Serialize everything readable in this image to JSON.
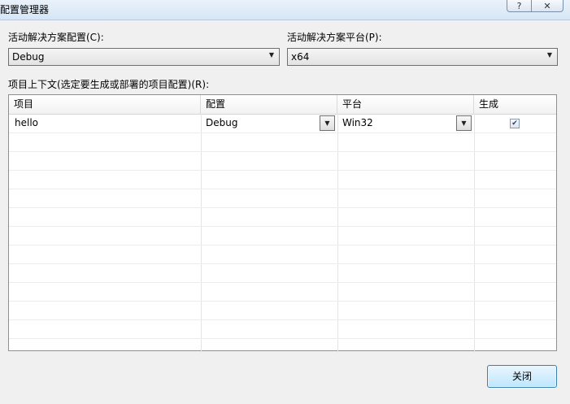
{
  "window": {
    "title": "配置管理器",
    "help_label": "?",
    "close_label": "✕"
  },
  "active_config": {
    "label": "活动解决方案配置(C):",
    "value": "Debug"
  },
  "active_platform": {
    "label": "活动解决方案平台(P):",
    "value": "x64"
  },
  "project_context": {
    "label": "项目上下文(选定要生成或部署的项目配置)(R):",
    "columns": [
      "项目",
      "配置",
      "平台",
      "生成"
    ],
    "rows": [
      {
        "project": "hello",
        "config": "Debug",
        "platform": "Win32",
        "build": true
      }
    ]
  },
  "buttons": {
    "close_label": "关闭"
  }
}
